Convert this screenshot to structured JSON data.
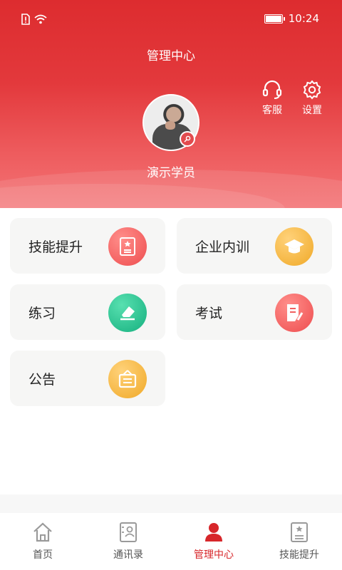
{
  "status": {
    "time": "10:24"
  },
  "header": {
    "title": "管理中心",
    "service_label": "客服",
    "settings_label": "设置"
  },
  "profile": {
    "name": "演示学员"
  },
  "menu": [
    {
      "label": "技能提升",
      "icon": "certificate-icon",
      "color": "#f15f5f"
    },
    {
      "label": "企业内训",
      "icon": "graduation-cap-icon",
      "color": "#f6b73c"
    },
    {
      "label": "练习",
      "icon": "eraser-icon",
      "color": "#22c08e"
    },
    {
      "label": "考试",
      "icon": "exam-paper-icon",
      "color": "#f15f5f"
    },
    {
      "label": "公告",
      "icon": "notice-board-icon",
      "color": "#f6b73c"
    }
  ],
  "tabs": [
    {
      "label": "首页",
      "icon": "home-icon"
    },
    {
      "label": "通讯录",
      "icon": "contacts-icon"
    },
    {
      "label": "管理中心",
      "icon": "user-icon",
      "active": true
    },
    {
      "label": "技能提升",
      "icon": "certificate-icon"
    }
  ],
  "colors": {
    "primary": "#d7262a",
    "header_top": "#dd2c2f",
    "card_bg": "#f6f6f5"
  }
}
